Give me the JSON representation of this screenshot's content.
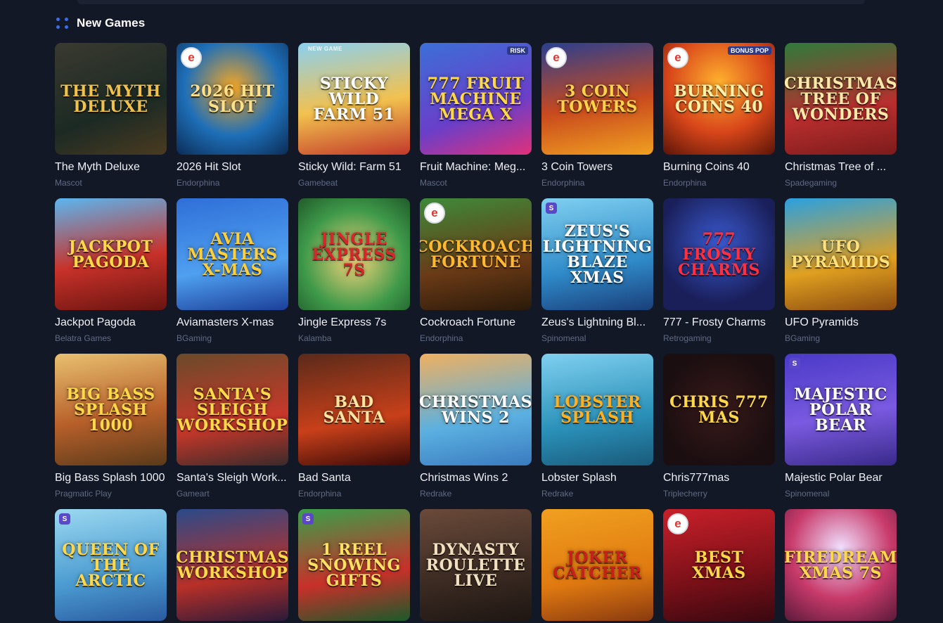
{
  "section": {
    "title": "New Games",
    "icon": "grid-dots-icon",
    "accent": "#3b6ee8"
  },
  "games": [
    {
      "name": "The Myth Deluxe",
      "provider": "Mascot",
      "art": "The Myth Deluxe",
      "bg": "linear-gradient(160deg,#3a3a30,#1c2a24 60%,#4b3b20)",
      "fg": "#f0c24a",
      "badge": ""
    },
    {
      "name": "2026 Hit Slot",
      "provider": "Endorphina",
      "art": "2026 Hit Slot",
      "bg": "radial-gradient(circle at 50% 40%,#f5a623,#1e6fb8 55%,#0b2c55)",
      "fg": "#ffe08a",
      "badge": "e"
    },
    {
      "name": "Sticky Wild: Farm 51",
      "provider": "Gamebeat",
      "art": "Sticky Wild Farm 51",
      "bg": "linear-gradient(170deg,#8bd0f0,#f2c14e 55%,#c2382a)",
      "fg": "#ffffff",
      "badge": "",
      "tag": "NEW GAME"
    },
    {
      "name": "Fruit Machine: Meg...",
      "provider": "Mascot",
      "art": "777 Fruit Machine Mega X",
      "bg": "linear-gradient(160deg,#3c6fd8,#6a3fc9 60%,#e0307a)",
      "fg": "#ffd84a",
      "badge": "",
      "corner": "RISK"
    },
    {
      "name": "3 Coin Towers",
      "provider": "Endorphina",
      "art": "3 Coin Towers",
      "bg": "linear-gradient(170deg,#2a3f8f,#c94a1e 55%,#f0a020)",
      "fg": "#ffd24a",
      "badge": "e"
    },
    {
      "name": "Burning Coins 40",
      "provider": "Endorphina",
      "art": "Burning Coins 40",
      "bg": "radial-gradient(circle at 50% 35%,#ffb02e,#d8461a 55%,#5a1408)",
      "fg": "#fff1a8",
      "badge": "e",
      "corner": "BONUS POP"
    },
    {
      "name": "Christmas Tree of ...",
      "provider": "Spadegaming",
      "art": "Christmas Tree of Wonders",
      "bg": "linear-gradient(170deg,#2f7a3a,#b92e2e 60%,#7c1b1b)",
      "fg": "#ffe9a8",
      "badge": ""
    },
    {
      "name": "Jackpot Pagoda",
      "provider": "Belatra Games",
      "art": "Jackpot Pagoda",
      "bg": "linear-gradient(170deg,#5bb6f0,#c8322a 55%,#6a1410)",
      "fg": "#ffd84a",
      "badge": ""
    },
    {
      "name": "Aviamasters X-mas",
      "provider": "BGaming",
      "art": "Avia Masters X-mas",
      "bg": "linear-gradient(170deg,#2f6fd8,#4fa0f0 60%,#1c3f9a)",
      "fg": "#ffcf3a",
      "badge": ""
    },
    {
      "name": "Jingle Express 7s",
      "provider": "Kalamba",
      "art": "Jingle Express 7s",
      "bg": "radial-gradient(circle at 50% 55%,#f6d37a,#3f9a4a 60%,#205a2a)",
      "fg": "#d8262a",
      "badge": ""
    },
    {
      "name": "Cockroach Fortune",
      "provider": "Endorphina",
      "art": "Cockroach Fortune",
      "bg": "linear-gradient(170deg,#3e8a3a,#6a3a16 60%,#2a1a0a)",
      "fg": "#ffb830",
      "badge": "e"
    },
    {
      "name": "Zeus's Lightning Bl...",
      "provider": "Spinomenal",
      "art": "Zeus's Lightning Blaze Xmas",
      "bg": "linear-gradient(170deg,#7fd0f0,#2f8ac8 60%,#1a3f7a)",
      "fg": "#ffffff",
      "badge": "s"
    },
    {
      "name": "777 - Frosty Charms",
      "provider": "Retrogaming",
      "art": "777 Frosty Charms",
      "bg": "radial-gradient(circle at 50% 40%,#3a5ad0,#1a1f5a 70%)",
      "fg": "#ff3040",
      "badge": ""
    },
    {
      "name": "UFO Pyramids",
      "provider": "BGaming",
      "art": "UFO Pyramids",
      "bg": "linear-gradient(170deg,#2aa0e0,#e0a020 60%,#8a4a10)",
      "fg": "#ffe07a",
      "badge": ""
    },
    {
      "name": "Big Bass Splash 1000",
      "provider": "Pragmatic Play",
      "art": "Big Bass Splash 1000",
      "bg": "linear-gradient(170deg,#e8c070,#b8602a 55%,#5a3a1a)",
      "fg": "#ffd84a",
      "badge": ""
    },
    {
      "name": "Santa's Sleigh Work...",
      "provider": "Gameart",
      "art": "Santa's Sleigh Workshop",
      "bg": "linear-gradient(170deg,#6a4a2a,#c8382a 60%,#3a2a2a)",
      "fg": "#ffd84a",
      "badge": ""
    },
    {
      "name": "Bad Santa",
      "provider": "Endorphina",
      "art": "Bad Santa",
      "bg": "linear-gradient(170deg,#5a2a1a,#c8401a 60%,#3a0a08)",
      "fg": "#ffe4a0",
      "badge": ""
    },
    {
      "name": "Christmas Wins 2",
      "provider": "Redrake",
      "art": "Christmas Wins 2",
      "bg": "linear-gradient(170deg,#f0b060,#5ab0e0 60%,#3a7ac0)",
      "fg": "#ffffff",
      "badge": ""
    },
    {
      "name": "Lobster Splash",
      "provider": "Redrake",
      "art": "Lobster Splash",
      "bg": "linear-gradient(170deg,#7fd0f0,#2a90b8 60%,#1a5a7a)",
      "fg": "#ffb020",
      "badge": ""
    },
    {
      "name": "Chris777mas",
      "provider": "Triplecherry",
      "art": "Chris 777 mas",
      "bg": "radial-gradient(circle at 50% 50%,#3a1a1a,#1a0e10 75%)",
      "fg": "#ffd84a",
      "badge": ""
    },
    {
      "name": "Majestic Polar Bear",
      "provider": "Spinomenal",
      "art": "Majestic Polar Bear",
      "bg": "linear-gradient(170deg,#4a3ac8,#7a5ae0 55%,#3a2a8a)",
      "fg": "#ffffff",
      "badge": "s"
    },
    {
      "name": "",
      "provider": "",
      "art": "Queen of the Arctic",
      "bg": "linear-gradient(170deg,#9ad8f0,#4a9ad0 60%,#2a5aa0)",
      "fg": "#ffd84a",
      "badge": "s"
    },
    {
      "name": "",
      "provider": "",
      "art": "Christmas Workshop",
      "bg": "linear-gradient(170deg,#2a4a8a,#b83028 60%,#2a1a3a)",
      "fg": "#ffd84a",
      "badge": ""
    },
    {
      "name": "",
      "provider": "",
      "art": "1 Reel Snowing Gifts",
      "bg": "linear-gradient(170deg,#3aa04a,#c8302a 60%,#1a5a2a)",
      "fg": "#ffe060",
      "badge": "s"
    },
    {
      "name": "",
      "provider": "",
      "art": "Dynasty Roulette Live",
      "bg": "linear-gradient(170deg,#6a4a3a,#3a2a22 60%,#1e1612)",
      "fg": "#f0e0c0",
      "badge": ""
    },
    {
      "name": "",
      "provider": "",
      "art": "Joker Catcher",
      "bg": "linear-gradient(170deg,#f0a020,#e07a10 60%,#8a3a10)",
      "fg": "#c8201a",
      "badge": ""
    },
    {
      "name": "",
      "provider": "",
      "art": "Best Xmas",
      "bg": "linear-gradient(170deg,#c8202a,#7a1018 60%,#3a0810)",
      "fg": "#ffd84a",
      "badge": "e"
    },
    {
      "name": "",
      "provider": "",
      "art": "Firedream Xmas 7s",
      "bg": "radial-gradient(circle at 50% 35%,#f0e0ff,#c83a6a 55%,#5a1a3a)",
      "fg": "#ffd84a",
      "badge": ""
    }
  ]
}
